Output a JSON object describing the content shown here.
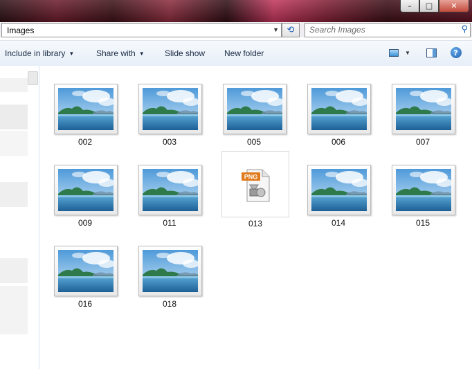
{
  "address": {
    "path": "Images"
  },
  "search": {
    "placeholder": "Search Images"
  },
  "window_buttons": {
    "minimize": "–",
    "maximize": "□",
    "close": "✕"
  },
  "toolbar": {
    "include_in_library": "Include in library",
    "share_with": "Share with",
    "slide_show": "Slide show",
    "new_folder": "New folder",
    "help": "?"
  },
  "icons": {
    "refresh": "refresh-icon",
    "search": "search-icon",
    "views": "change-view-icon",
    "preview_pane": "preview-pane-icon",
    "help": "help-icon",
    "image_thumbnail": "landscape-thumbnail",
    "png_file": "png-file-icon"
  },
  "colors": {
    "toolbar_text": "#1a2a44",
    "accent": "#1e5fb4"
  },
  "files": [
    {
      "name": "002",
      "type": "image"
    },
    {
      "name": "003",
      "type": "image"
    },
    {
      "name": "005",
      "type": "image"
    },
    {
      "name": "006",
      "type": "image"
    },
    {
      "name": "007",
      "type": "image"
    },
    {
      "name": "009",
      "type": "image"
    },
    {
      "name": "011",
      "type": "image"
    },
    {
      "name": "013",
      "type": "png",
      "badge": "PNG"
    },
    {
      "name": "014",
      "type": "image"
    },
    {
      "name": "015",
      "type": "image"
    },
    {
      "name": "016",
      "type": "image"
    },
    {
      "name": "018",
      "type": "image"
    }
  ]
}
